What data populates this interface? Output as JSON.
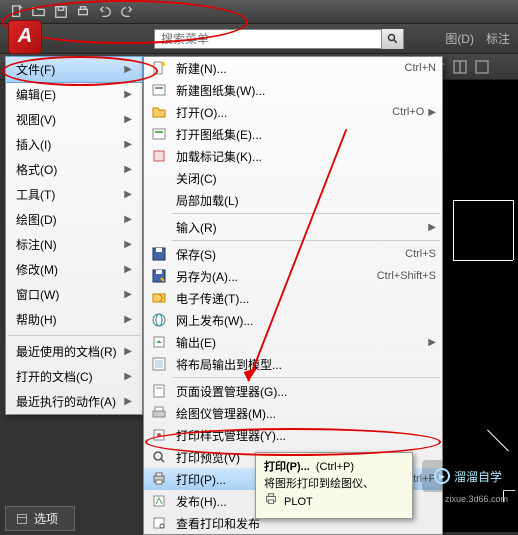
{
  "titlebar_icons": [
    "new-doc-icon",
    "open-icon",
    "save-icon",
    "print-icon",
    "undo-icon",
    "redo-icon"
  ],
  "search": {
    "placeholder": "搜索菜单"
  },
  "menubar_right": {
    "view": "图(D)",
    "annotate": "标注"
  },
  "left_menu": {
    "items": [
      {
        "label": "文件(F)",
        "has_sub": true,
        "active": true
      },
      {
        "label": "编辑(E)",
        "has_sub": true
      },
      {
        "label": "视图(V)",
        "has_sub": true
      },
      {
        "label": "插入(I)",
        "has_sub": true
      },
      {
        "label": "格式(O)",
        "has_sub": true
      },
      {
        "label": "工具(T)",
        "has_sub": true
      },
      {
        "label": "绘图(D)",
        "has_sub": true
      },
      {
        "label": "标注(N)",
        "has_sub": true
      },
      {
        "label": "修改(M)",
        "has_sub": true
      },
      {
        "label": "窗口(W)",
        "has_sub": true
      },
      {
        "label": "帮助(H)",
        "has_sub": true
      }
    ],
    "recent": [
      {
        "label": "最近使用的文档(R)",
        "has_sub": true
      },
      {
        "label": "打开的文档(C)",
        "has_sub": true
      },
      {
        "label": "最近执行的动作(A)",
        "has_sub": true
      }
    ]
  },
  "options_label": "选项",
  "submenu": {
    "groups": [
      [
        {
          "label": "新建(N)...",
          "shortcut": "Ctrl+N",
          "icon": "new"
        },
        {
          "label": "新建图纸集(W)...",
          "icon": "sheetset"
        },
        {
          "label": "打开(O)...",
          "shortcut": "Ctrl+O",
          "icon": "open",
          "has_sub": true
        },
        {
          "label": "打开图纸集(E)...",
          "icon": "sheetset"
        },
        {
          "label": "加载标记集(K)...",
          "icon": "markup"
        },
        {
          "label": "关闭(C)",
          "icon": ""
        },
        {
          "label": "局部加载(L)",
          "icon": ""
        }
      ],
      [
        {
          "label": "输入(R)",
          "icon": "",
          "has_sub": true
        }
      ],
      [
        {
          "label": "保存(S)",
          "shortcut": "Ctrl+S",
          "icon": "save"
        },
        {
          "label": "另存为(A)...",
          "shortcut": "Ctrl+Shift+S",
          "icon": "saveas"
        },
        {
          "label": "电子传递(T)...",
          "icon": "etransmit"
        },
        {
          "label": "网上发布(W)...",
          "icon": "web"
        },
        {
          "label": "输出(E)",
          "icon": "export",
          "has_sub": true
        },
        {
          "label": "将布局输出到模型...",
          "icon": "layout"
        }
      ],
      [
        {
          "label": "页面设置管理器(G)...",
          "icon": "page"
        },
        {
          "label": "绘图仪管理器(M)...",
          "icon": "plotter"
        },
        {
          "label": "打印样式管理器(Y)...",
          "icon": "plotstyle"
        },
        {
          "label": "打印预览(V)",
          "icon": "preview"
        },
        {
          "label": "打印(P)...",
          "shortcut": "Ctrl+P",
          "icon": "print",
          "highlight": true
        },
        {
          "label": "发布(H)...",
          "icon": "publish"
        },
        {
          "label": "查看打印和发布",
          "icon": "log"
        }
      ]
    ]
  },
  "tooltip": {
    "line1_label": "打印(P)...",
    "line1_short": "(Ctrl+P)",
    "line2": "将图形打印到绘图仪、",
    "line3_icon": "printer-icon",
    "line3_label": "PLOT"
  },
  "watermark": {
    "text": "溜溜自学",
    "sub": "zixue.3d66.com"
  }
}
